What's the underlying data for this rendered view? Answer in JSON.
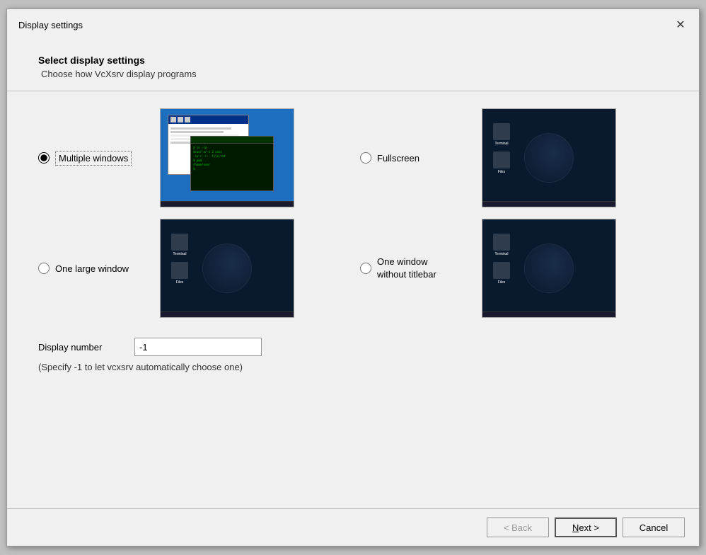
{
  "dialog": {
    "title": "Display settings",
    "close_label": "✕"
  },
  "header": {
    "title": "Select display settings",
    "subtitle": "Choose how VcXsrv display programs"
  },
  "options": [
    {
      "id": "multiple-windows",
      "label": "Multiple windows",
      "checked": true
    },
    {
      "id": "fullscreen",
      "label": "Fullscreen",
      "checked": false
    },
    {
      "id": "one-large-window",
      "label": "One large window",
      "checked": false
    },
    {
      "id": "one-window-notitlebar",
      "label": "One window\nwithout titlebar",
      "checked": false
    }
  ],
  "display_number": {
    "label": "Display number",
    "value": "-1",
    "hint": "(Specify -1 to let vcxsrv automatically choose one)"
  },
  "footer": {
    "back_label": "< Back",
    "next_label": "Next >",
    "cancel_label": "Cancel"
  }
}
